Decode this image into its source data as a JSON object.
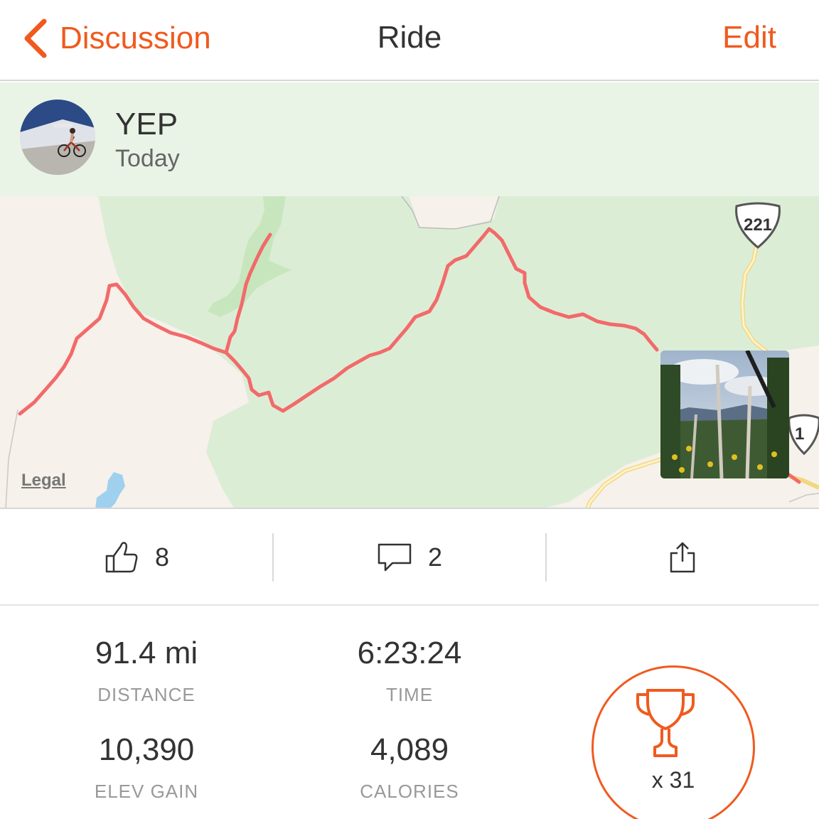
{
  "nav": {
    "back_label": "Discussion",
    "title": "Ride",
    "edit_label": "Edit"
  },
  "athlete": {
    "name": "YEP",
    "date": "Today"
  },
  "map": {
    "legal_label": "Legal",
    "route_shields": [
      "221",
      "1"
    ],
    "route_color": "#f26a6a"
  },
  "actions": {
    "kudos_count": "8",
    "comments_count": "2"
  },
  "stats": {
    "distance": {
      "value": "91.4 mi",
      "label": "DISTANCE"
    },
    "time": {
      "value": "6:23:24",
      "label": "TIME"
    },
    "elev_gain": {
      "value": "10,390",
      "label": "ELEV GAIN"
    },
    "calories": {
      "value": "4,089",
      "label": "CALORIES"
    }
  },
  "achievements": {
    "count_label": "x 31"
  },
  "colors": {
    "accent": "#f05a1e",
    "header_bg": "#eaf4e6",
    "map_green": "#dcedd6"
  }
}
